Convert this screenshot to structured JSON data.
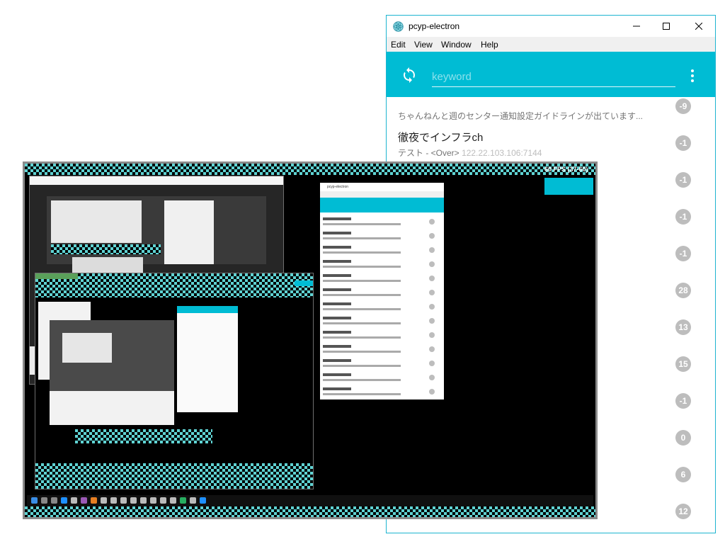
{
  "window": {
    "title": "pcyp-electron",
    "controls": {
      "minimize": "minimize-icon",
      "maximize": "maximize-icon",
      "close": "close-icon"
    }
  },
  "menu": {
    "items": [
      "Edit",
      "View",
      "Window",
      "Help"
    ]
  },
  "toolbar": {
    "search_placeholder": "keyword",
    "accent": "#00bcd4"
  },
  "channels": [
    {
      "name": "",
      "sub": "ちゃんねんと週のセンター通知設定ガイドラインが出ています...",
      "ip": "",
      "count": "-9"
    },
    {
      "name": "徹夜でインフラch",
      "sub": "テスト - <Over>",
      "ip": "122.22.103.106:7144",
      "count": "-1"
    },
    {
      "name": "",
      "sub": "",
      "ip": "",
      "count": "-1"
    },
    {
      "name": "",
      "sub": "",
      "ip": "",
      "count": "-1"
    },
    {
      "name": "",
      "sub": "",
      "ip": "",
      "count": "-1"
    },
    {
      "name": "",
      "sub": "",
      "ip": "",
      "count": "28"
    },
    {
      "name": "",
      "sub": "",
      "ip": "",
      "count": "13"
    },
    {
      "name": "",
      "sub": "",
      "ip": "",
      "count": "15"
    },
    {
      "name": "",
      "sub": "",
      "ip": "",
      "count": "-1"
    },
    {
      "name": "",
      "sub": "",
      "ip": "",
      "count": "0"
    },
    {
      "name": "",
      "sub": "",
      "ip": "",
      "count": "6"
    },
    {
      "name": "",
      "sub": "",
      "ip": "",
      "count": "12"
    }
  ],
  "preview": {
    "fps_text": "60 FPS (37-60)"
  }
}
